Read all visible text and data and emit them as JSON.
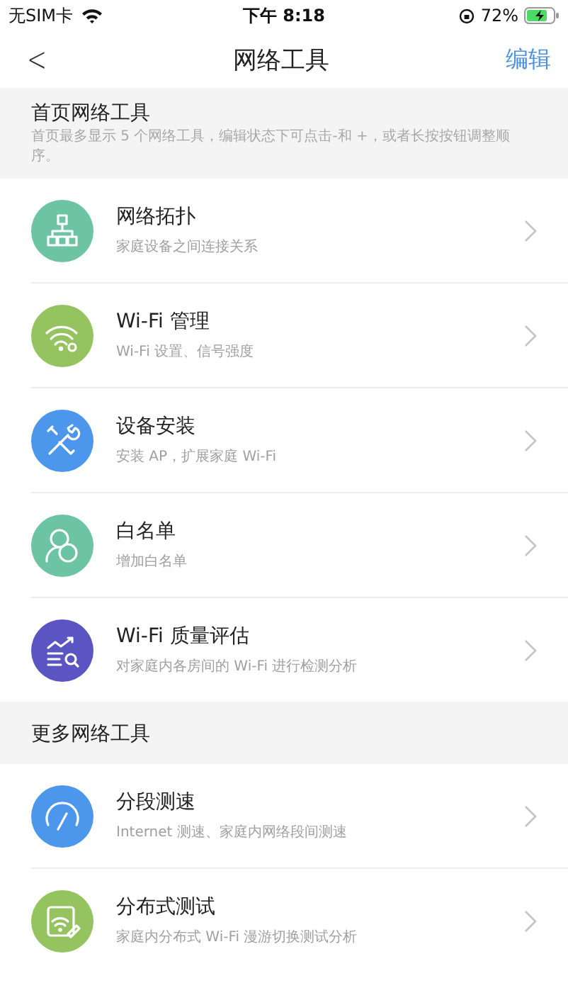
{
  "status_bar": {
    "carrier": "无SIM卡",
    "time": "下午 8:18",
    "battery": "72%"
  },
  "nav": {
    "back": "<",
    "title": "网络工具",
    "action": "编辑"
  },
  "sections": [
    {
      "title": "首页网络工具",
      "description": "首页最多显示 5 个网络工具，编辑状态下可点击-和 +，或者长按按钮调整顺序。",
      "items": [
        {
          "kind": "topology",
          "color": "#6cc4a4",
          "title": "网络拓扑",
          "subtitle": "家庭设备之间连接关系"
        },
        {
          "kind": "wifi",
          "color": "#94c35f",
          "title": "Wi-Fi 管理",
          "subtitle": "Wi-Fi 设置、信号强度"
        },
        {
          "kind": "tools",
          "color": "#4c97eb",
          "title": "设备安装",
          "subtitle": "安装 AP，扩展家庭 Wi-Fi"
        },
        {
          "kind": "person",
          "color": "#6cc4a4",
          "title": "白名单",
          "subtitle": "增加白名单"
        },
        {
          "kind": "chart",
          "color": "#5a55c2",
          "title": "Wi-Fi 质量评估",
          "subtitle": "对家庭内各房间的 Wi-Fi 进行检测分析"
        }
      ]
    },
    {
      "title": "更多网络工具",
      "items": [
        {
          "kind": "gauge",
          "color": "#4c97eb",
          "title": "分段测速",
          "subtitle": "Internet 测速、家庭内网络段间测速"
        },
        {
          "kind": "roam",
          "color": "#94c35f",
          "title": "分布式测试",
          "subtitle": "家庭内分布式 Wi-Fi 漫游切换测试分析"
        }
      ]
    }
  ]
}
